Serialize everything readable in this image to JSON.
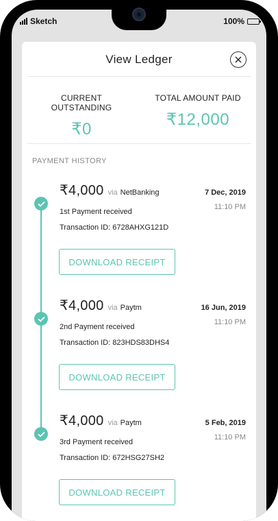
{
  "status_bar": {
    "carrier": "Sketch",
    "battery": "100%"
  },
  "ledger": {
    "title": "View Ledger",
    "close_icon": "close-icon",
    "current_outstanding": {
      "label": "CURRENT OUTSTANDING",
      "value": "₹0"
    },
    "total_paid": {
      "label": "TOTAL AMOUNT PAID",
      "value": "₹12,000"
    },
    "history_label": "PAYMENT HISTORY",
    "payments": [
      {
        "amount": "₹4,000",
        "via_label": "via",
        "method": "NetBanking",
        "date": "7 Dec, 2019",
        "time": "11:10 PM",
        "ordinal": "1st Payment received",
        "transaction": "Transaction ID: 6728AHXG121D",
        "button": "DOWNLOAD RECEIPT"
      },
      {
        "amount": "₹4,000",
        "via_label": "via",
        "method": "Paytm",
        "date": "16 Jun, 2019",
        "time": "11:10 PM",
        "ordinal": "2nd Payment received",
        "transaction": "Transaction ID: 823HDS83DHS4",
        "button": "DOWNLOAD RECEIPT"
      },
      {
        "amount": "₹4,000",
        "via_label": "via",
        "method": "Paytm",
        "date": "5 Feb, 2019",
        "time": "11:10 PM",
        "ordinal": "3rd Payment received",
        "transaction": "Transaction ID: 672HSG27SH2",
        "button": "DOWNLOAD RECEIPT"
      }
    ]
  },
  "colors": {
    "accent": "#5bc4b2",
    "text": "#222222",
    "muted": "#888888"
  }
}
